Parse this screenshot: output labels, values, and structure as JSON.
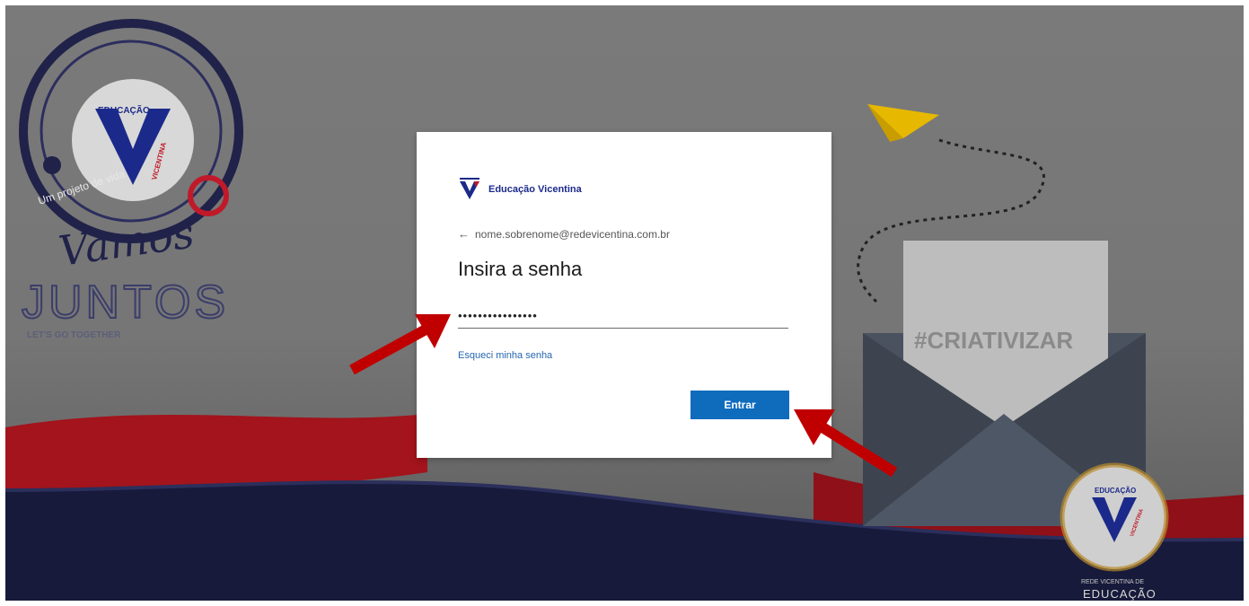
{
  "card": {
    "brand": "Educação Vicentina",
    "identity_email": "nome.sobrenome@redevicentina.com.br",
    "back_glyph": "←",
    "title": "Insira a senha",
    "password_value": "••••••••••••••••",
    "forgot_label": "Esqueci minha senha",
    "submit_label": "Entrar"
  },
  "background": {
    "logo_top": "EDUCAÇÃO",
    "logo_side": "VICENTINA",
    "tagline": "Um projeto de vida",
    "script_word": "Vamos",
    "big_word": "JUNTOS",
    "subline": "LET'S GO TOGETHER",
    "hashtag": "#CRIATIVIZAR",
    "seal_top": "EDUCAÇÃO",
    "seal_side": "VICENTINA",
    "footer_line1": "REDE VICENTINA DE",
    "footer_line2": "EDUCAÇÃO"
  },
  "colors": {
    "accent": "#0f6cbd",
    "brand_navy": "#1b2a8a",
    "annotation_red": "#c00000",
    "wave_red": "#a3141c",
    "wave_navy": "#171a3a"
  },
  "icons": {
    "back": "arrow-left-icon",
    "annotation": "red-arrow-icon"
  }
}
